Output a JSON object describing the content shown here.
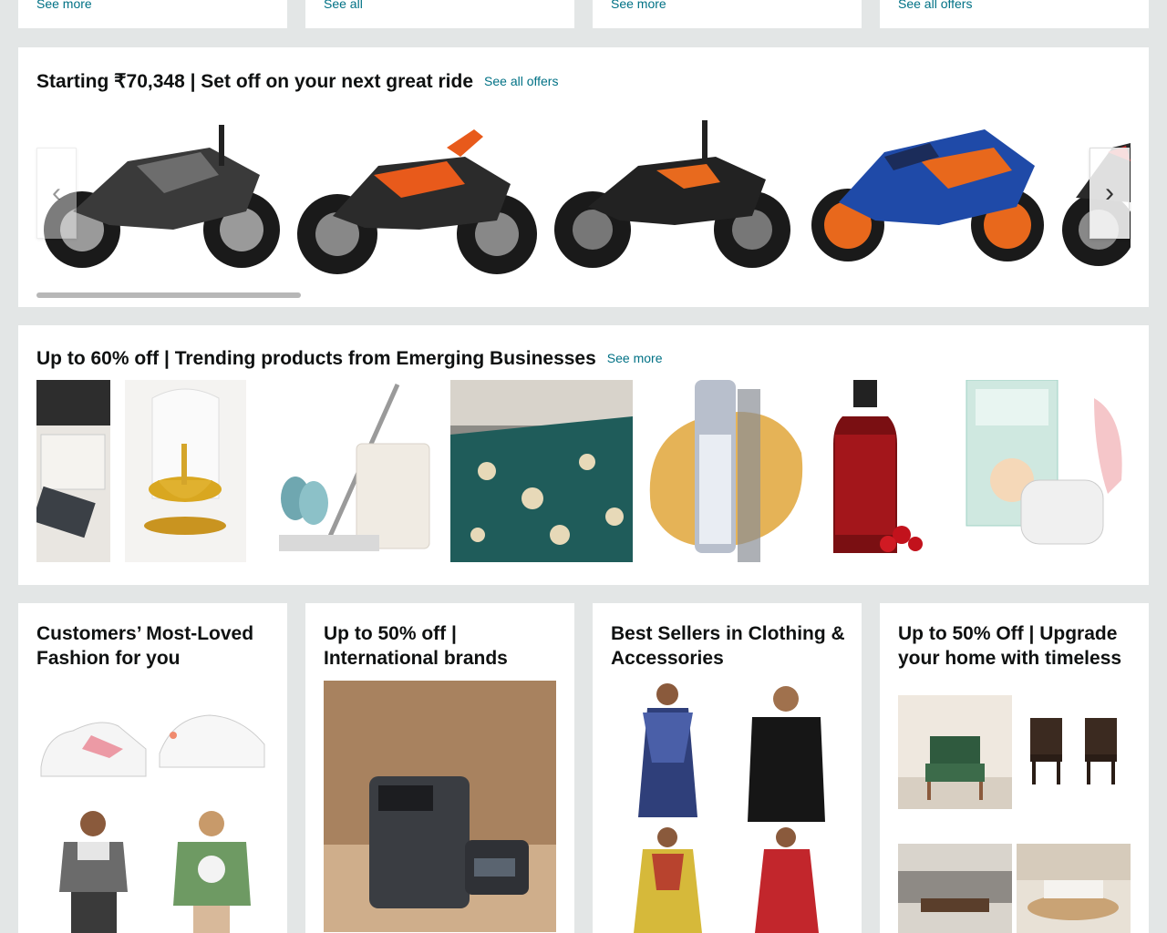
{
  "top_row": {
    "links": [
      "See more",
      "See all",
      "See more",
      "See all offers"
    ]
  },
  "bikes_section": {
    "title": "Starting ₹70,348 | Set off on your next great ride",
    "link": "See all offers",
    "prev_icon": "chevron-left-icon",
    "next_icon": "chevron-right-icon",
    "items": [
      {
        "name": "bike-pulsar-rs",
        "accent": "#3a3a3a"
      },
      {
        "name": "bike-pulsar-ns-orange",
        "accent": "#e85a1b"
      },
      {
        "name": "bike-duke-black",
        "accent": "#222222"
      },
      {
        "name": "bike-rc-blue",
        "accent": "#1f4aa8"
      }
    ]
  },
  "trending_section": {
    "title": "Up to 60% off | Trending products from Emerging Businesses",
    "link": "See more"
  },
  "cards": [
    {
      "title": "Customers’ Most-Loved Fashion for you"
    },
    {
      "title": "Up to 50% off | International brands"
    },
    {
      "title": "Best Sellers in Clothing & Accessories"
    },
    {
      "title": "Up to 50% Off | Upgrade your home with timeless"
    }
  ],
  "colors": {
    "background": "#e3e6e6",
    "link": "#007185",
    "text": "#0f1111"
  }
}
